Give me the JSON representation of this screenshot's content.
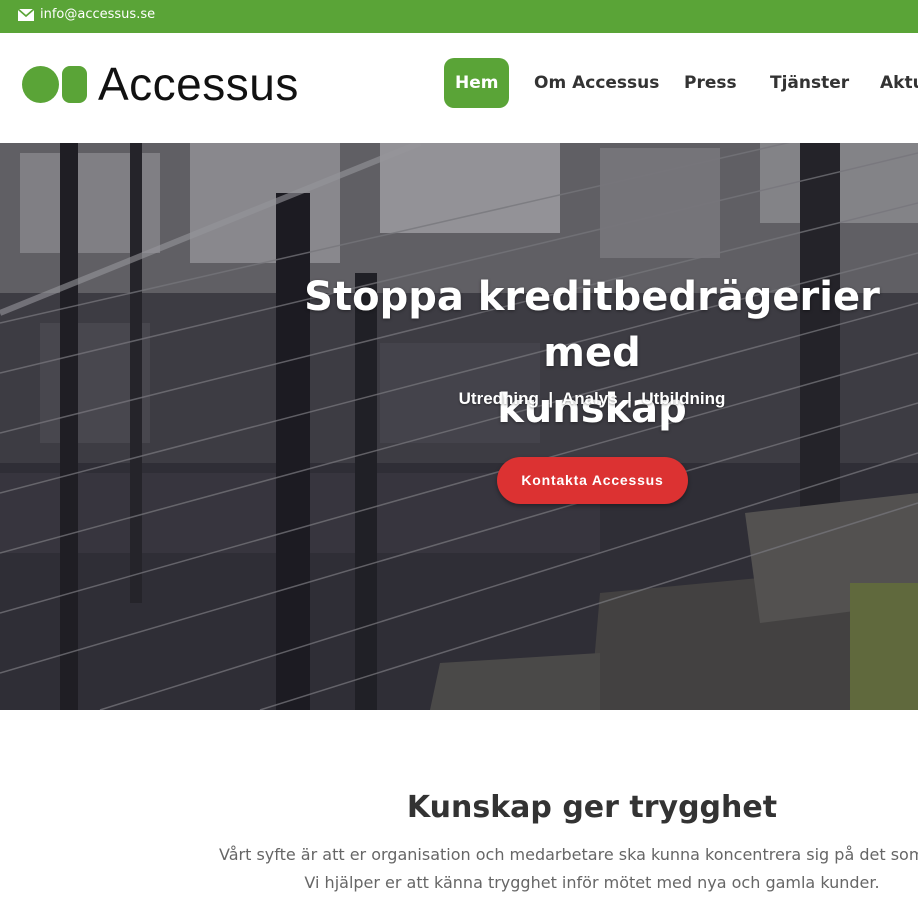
{
  "topbar": {
    "email": "info@accessus.se",
    "icon": "mail-icon",
    "color": "#5aa437"
  },
  "header": {
    "logo_text": "Accessus",
    "brand_color": "#5aa437",
    "nav": {
      "items": [
        {
          "label": "Hem",
          "active": true
        },
        {
          "label": "Om Accessus"
        },
        {
          "label": "Press"
        },
        {
          "label": "Tjänster"
        },
        {
          "label": "Aktu"
        }
      ]
    }
  },
  "hero": {
    "title_line1": "Stoppa kreditbedrägerier med",
    "title_line2": "kunskap",
    "subtitle": "Utredning  |  Analys  |  Utbildning",
    "cta_label": "Kontakta Accessus",
    "cta_color": "#dc3232"
  },
  "section": {
    "title": "Kunskap ger trygghet",
    "line1": "Vårt syfte är att er organisation och medarbetare ska kunna koncentrera sig på det som de kan",
    "line2": "Vi hjälper er att känna trygghet inför mötet med nya och gamla kunder."
  }
}
